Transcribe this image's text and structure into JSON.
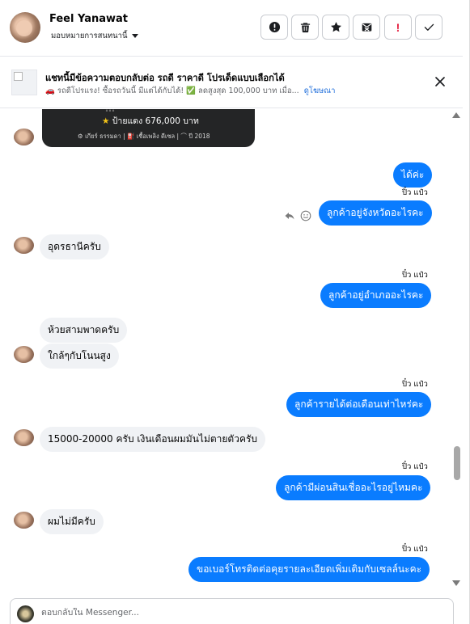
{
  "header": {
    "contact_name": "Feel Yanawat",
    "assign_label": "มอบหมายการสนทนานี้",
    "buttons": [
      {
        "name": "report-button",
        "icon": "exclamation-circle-icon"
      },
      {
        "name": "delete-button",
        "icon": "trash-icon"
      },
      {
        "name": "star-button",
        "icon": "star-icon"
      },
      {
        "name": "archive-button",
        "icon": "envelope-x-icon"
      },
      {
        "name": "spam-button",
        "icon": "red-exclamation-icon"
      },
      {
        "name": "done-button",
        "icon": "check-icon"
      }
    ],
    "spam_glyph": "!"
  },
  "ad_banner": {
    "title": "แชทนี้มีข้อความตอบกลับต่อ รถดี ราคาดี โปรเด็ดแบบเลือกได้",
    "line": "🚗 รถดีโปรแรง! ซื้อรถวันนี้ มีแต่ได้กับได้! ✅ ลดสูงสุด 100,000 บาท เมื่อ...",
    "link": "ดูโฆษณา"
  },
  "ad_card": {
    "top": "…",
    "star": "★",
    "price": "ป้ายแดง 676,000 บาท",
    "specs": "⚙ เกียร์ ธรรมดา  |  ⛽ เชื้อเพลิง ดีเซล  |  ⌒ ปี 2018"
  },
  "messages": [
    {
      "id": "m1",
      "from": "me",
      "text": "ได้ค่ะ"
    },
    {
      "id": "m2",
      "from": "me",
      "text": "ลูกค้าอยู่จังหวัดอะไรคะ",
      "status": "ปิ๋ว แป๋ว"
    },
    {
      "id": "m3",
      "from": "them",
      "text": "อุดรธานีครับ"
    },
    {
      "id": "m4",
      "from": "me",
      "text": "ลูกค้าอยู่อำเภออะไรคะ",
      "status": "ปิ๋ว แป๋ว"
    },
    {
      "id": "m5",
      "from": "them",
      "text": "ห้วยสามพาดครับ"
    },
    {
      "id": "m6",
      "from": "them",
      "text": "ใกล้ๆกับโนนสูง"
    },
    {
      "id": "m7",
      "from": "me",
      "text": "ลูกค้ารายได้ต่อเดือนเท่าไหร่คะ",
      "status": "ปิ๋ว แป๋ว"
    },
    {
      "id": "m8",
      "from": "them",
      "text": "15000-20000 ครับ เงินเดือนผมมันไม่ตายตัวครับ"
    },
    {
      "id": "m9",
      "from": "me",
      "text": "ลูกค้ามีผ่อนสินเชื่ออะไรอยู่ไหมคะ",
      "status": "ปิ๋ว แป๋ว"
    },
    {
      "id": "m10",
      "from": "them",
      "text": "ผมไม่มีครับ"
    },
    {
      "id": "m11",
      "from": "me",
      "text": "ขอเบอร์โทรติดต่อคุยรายละเอียดเพิ่มเติมกับเซลล์นะคะ",
      "status": "ปิ๋ว แป๋ว"
    }
  ],
  "composer": {
    "placeholder": "ตอบกลับใน Messenger..."
  },
  "colors": {
    "outgoing_bubble": "#0a7cff",
    "incoming_bubble": "#f0f2f5",
    "link": "#216fdb",
    "spam_red": "#e41e3f"
  }
}
